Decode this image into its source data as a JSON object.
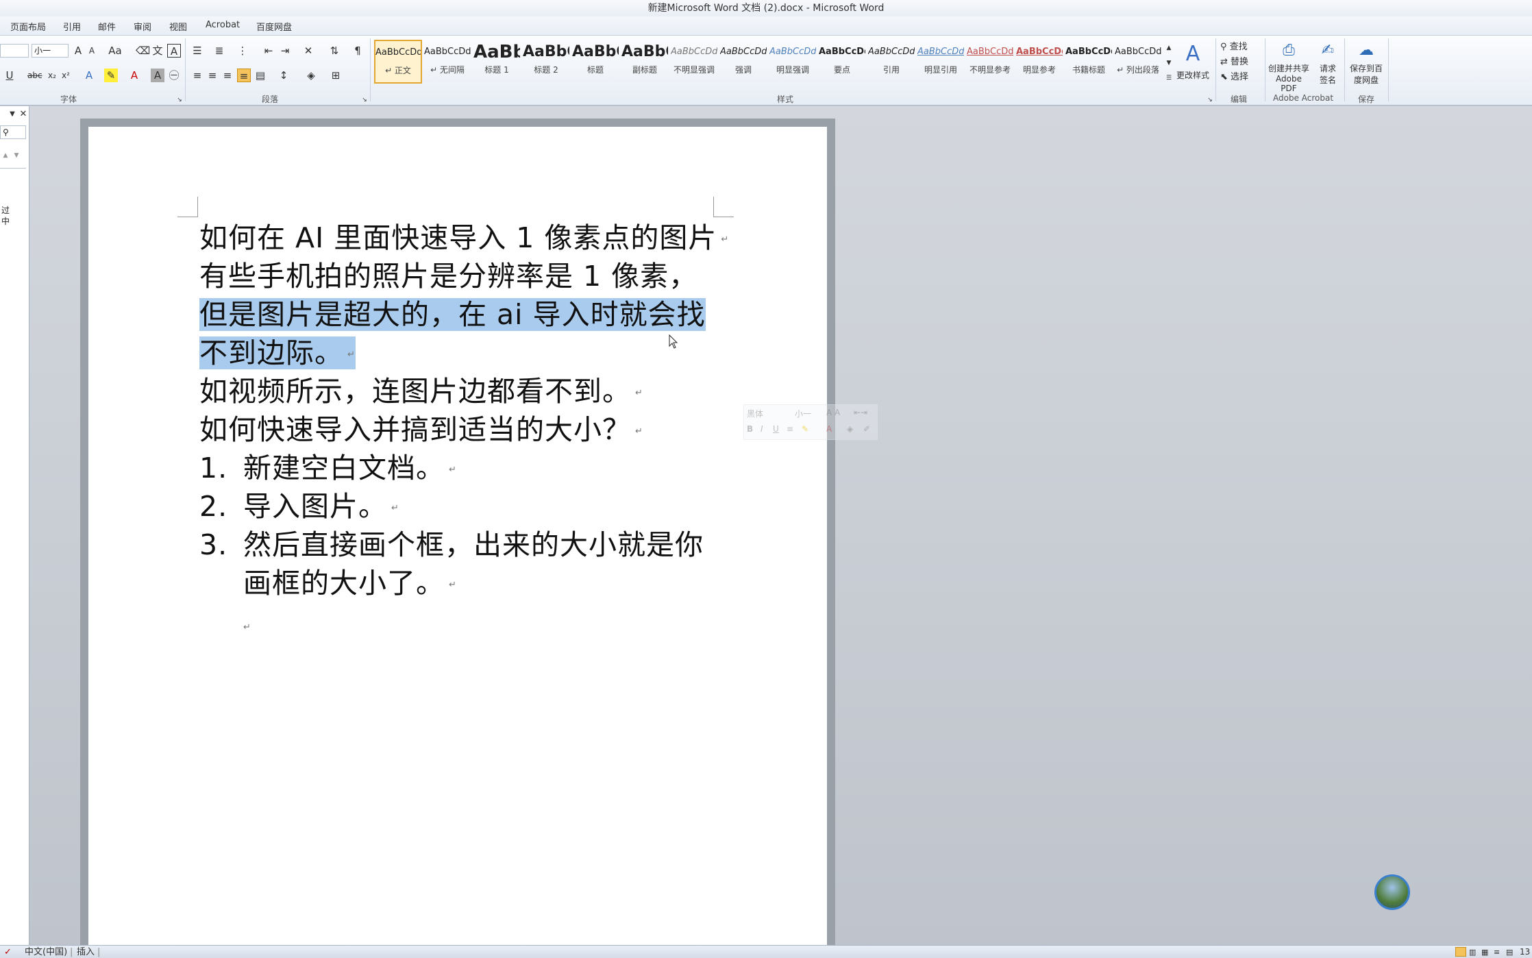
{
  "window": {
    "title": "新建Microsoft Word 文档 (2).docx - Microsoft Word"
  },
  "tabs": [
    "页面布局",
    "引用",
    "邮件",
    "审阅",
    "视图",
    "Acrobat",
    "百度网盘"
  ],
  "ribbon": {
    "font": {
      "size_value": "小一",
      "group_label": "字体"
    },
    "paragraph": {
      "group_label": "段落"
    },
    "styles": {
      "group_label": "样式",
      "items": [
        {
          "preview": "AaBbCcDd",
          "name": "↵ 正文"
        },
        {
          "preview": "AaBbCcDd",
          "name": "↵ 无间隔"
        },
        {
          "preview": "AaBb",
          "name": "标题 1"
        },
        {
          "preview": "AaBbC",
          "name": "标题 2"
        },
        {
          "preview": "AaBbC",
          "name": "标题"
        },
        {
          "preview": "AaBbC",
          "name": "副标题"
        },
        {
          "preview": "AaBbCcDd",
          "name": "不明显强调"
        },
        {
          "preview": "AaBbCcDd",
          "name": "强调"
        },
        {
          "preview": "AaBbCcDd",
          "name": "明显强调"
        },
        {
          "preview": "AaBbCcDd",
          "name": "要点"
        },
        {
          "preview": "AaBbCcDd",
          "name": "引用"
        },
        {
          "preview": "AaBbCcDd",
          "name": "明显引用"
        },
        {
          "preview": "AaBbCcDd",
          "name": "不明显参考"
        },
        {
          "preview": "AaBbCcDd",
          "name": "明显参考"
        },
        {
          "preview": "AaBbCcDd",
          "name": "书籍标题"
        },
        {
          "preview": "AaBbCcDd",
          "name": "↵ 列出段落"
        }
      ],
      "change_styles": "更改样式"
    },
    "editing": {
      "group_label": "编辑",
      "find": "查找",
      "replace": "替换",
      "select": "选择"
    },
    "acrobat": {
      "group_label": "Adobe Acrobat",
      "create_pdf_line1": "创建并共享",
      "create_pdf_line2": "Adobe PDF",
      "sign_line1": "请求",
      "sign_line2": "签名"
    },
    "save": {
      "group_label": "保存",
      "save_line1": "保存到百",
      "save_line2": "度网盘"
    }
  },
  "navpane": {
    "snippet_line1": "过",
    "snippet_line2": "中"
  },
  "document": {
    "lines": [
      "如何在 AI 里面快速导入 1 像素点的图片",
      "有些手机拍的照片是分辨率是 1 像素，",
      "但是图片是超大的，在 ai 导入时就会找",
      "不到边际。",
      "如视频所示，连图片边都看不到。",
      "如何快速导入并搞到适当的大小？"
    ],
    "list": [
      {
        "num": "1.",
        "text": "新建空白文档。"
      },
      {
        "num": "2.",
        "text": "导入图片。"
      },
      {
        "num": "3.",
        "text": "然后直接画个框，出来的大小就是你"
      }
    ],
    "list_continuation": "画框的大小了。",
    "para_mark": "↵"
  },
  "minitoolbar": {
    "font": "黑体",
    "size": "小一"
  },
  "status": {
    "language": "中文(中国)",
    "mode": "插入",
    "zoom": "13"
  },
  "colors": {
    "selection": "#a9cbee",
    "accent": "#e3a631"
  }
}
